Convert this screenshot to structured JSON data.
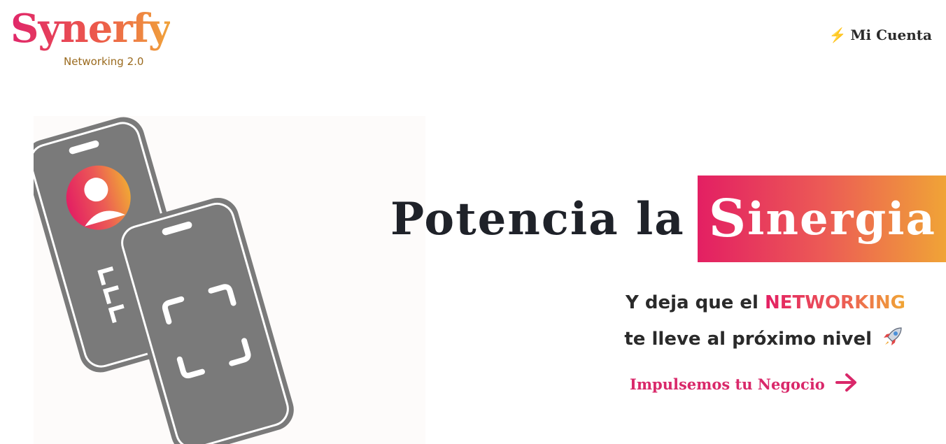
{
  "header": {
    "logo_text": "Synerfy",
    "logo_tagline": "Networking 2.0",
    "account_label": "Mi Cuenta",
    "account_icon": "lightning-icon"
  },
  "hero": {
    "title_plain": "Potencia la",
    "title_highlight_initial": "S",
    "title_highlight_rest": "inergia",
    "subtitle_pre": "Y deja que el",
    "subtitle_emphasis": "NETWORKING",
    "subtitle_line2": "te lleve al próximo nivel",
    "subtitle_icon": "rocket-icon",
    "cta_label": "Impulsemos tu Negocio",
    "cta_icon": "arrow-right-icon"
  },
  "colors": {
    "brand_pink": "#e31f63",
    "brand_orange": "#f0a735",
    "phone_gray": "#7a7a7a",
    "text_dark": "#1f2229"
  }
}
